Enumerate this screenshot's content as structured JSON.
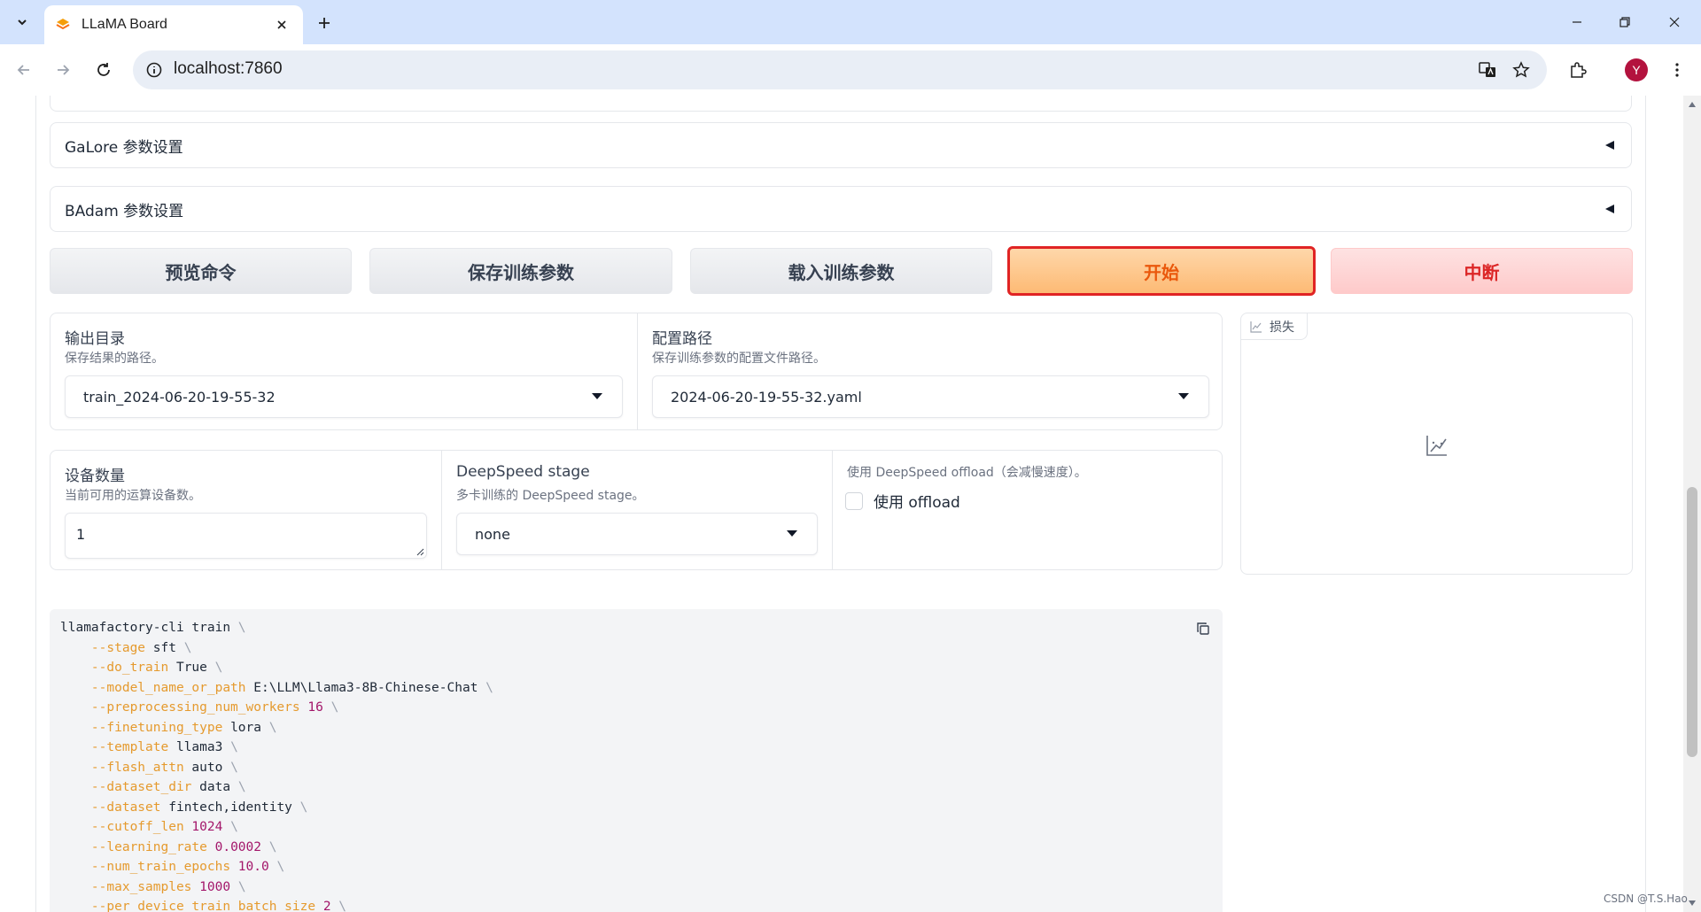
{
  "browser": {
    "tab_title": "LLaMA Board",
    "url": "localhost:7860",
    "profile_initial": "Y"
  },
  "accordions": [
    {
      "label": "GaLore 参数设置"
    },
    {
      "label": "BAdam 参数设置"
    }
  ],
  "actions": {
    "preview": "预览命令",
    "save": "保存训练参数",
    "load": "载入训练参数",
    "start": "开始",
    "abort": "中断"
  },
  "output_dir": {
    "label": "输出目录",
    "info": "保存结果的路径。",
    "value": "train_2024-06-20-19-55-32"
  },
  "config_path": {
    "label": "配置路径",
    "info": "保存训练参数的配置文件路径。",
    "value": "2024-06-20-19-55-32.yaml"
  },
  "device_count": {
    "label": "设备数量",
    "info": "当前可用的运算设备数。",
    "value": "1"
  },
  "ds_stage": {
    "label": "DeepSpeed stage",
    "info": "多卡训练的 DeepSpeed stage。",
    "value": "none"
  },
  "ds_offload": {
    "info": "使用 DeepSpeed offload（会减慢速度）。",
    "checkbox_label": "使用 offload",
    "checked": false
  },
  "loss_plot": {
    "label": "损失"
  },
  "command": {
    "first_line": "llamafactory-cli train",
    "args": [
      {
        "flag": "--stage",
        "value": "sft",
        "numeric": false
      },
      {
        "flag": "--do_train",
        "value": "True",
        "numeric": false
      },
      {
        "flag": "--model_name_or_path",
        "value": "E:\\LLM\\Llama3-8B-Chinese-Chat",
        "numeric": false
      },
      {
        "flag": "--preprocessing_num_workers",
        "value": "16",
        "numeric": true
      },
      {
        "flag": "--finetuning_type",
        "value": "lora",
        "numeric": false
      },
      {
        "flag": "--template",
        "value": "llama3",
        "numeric": false
      },
      {
        "flag": "--flash_attn",
        "value": "auto",
        "numeric": false
      },
      {
        "flag": "--dataset_dir",
        "value": "data",
        "numeric": false
      },
      {
        "flag": "--dataset",
        "value": "fintech,identity",
        "numeric": false
      },
      {
        "flag": "--cutoff_len",
        "value": "1024",
        "numeric": true
      },
      {
        "flag": "--learning_rate",
        "value": "0.0002",
        "numeric": true
      },
      {
        "flag": "--num_train_epochs",
        "value": "10.0",
        "numeric": true
      },
      {
        "flag": "--max_samples",
        "value": "1000",
        "numeric": true
      },
      {
        "flag": "--per_device_train_batch_size",
        "value": "2",
        "numeric": true
      }
    ]
  },
  "watermark": "CSDN @T.S.Hao",
  "colors": {
    "start_accent": "#ea580c",
    "abort_accent": "#dc2626",
    "highlight_border": "#e02424",
    "code_flag": "#e59a2e",
    "code_number": "#a3166a"
  }
}
